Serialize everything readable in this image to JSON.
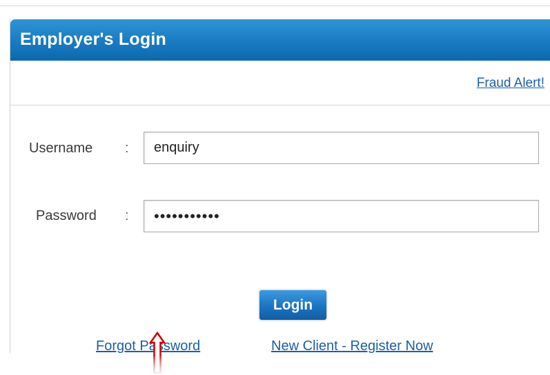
{
  "login_panel": {
    "title": "Employer's Login",
    "fraud_alert_link": "Fraud Alert!",
    "username": {
      "label": "Username",
      "separator": ":",
      "value": "enquiry"
    },
    "password": {
      "label": "Password",
      "separator": ":",
      "value": "•••••••••••"
    },
    "login_button": "Login",
    "forgot_password_link": "Forgot Password",
    "register_link": "New Client - Register Now"
  },
  "annotation": {
    "arrow_color": "#cc0000",
    "icon": "up-arrow-icon"
  },
  "colors": {
    "header_blue": "#1b7dc4",
    "link_blue": "#1a5fa8",
    "button_blue": "#1b73c2"
  }
}
